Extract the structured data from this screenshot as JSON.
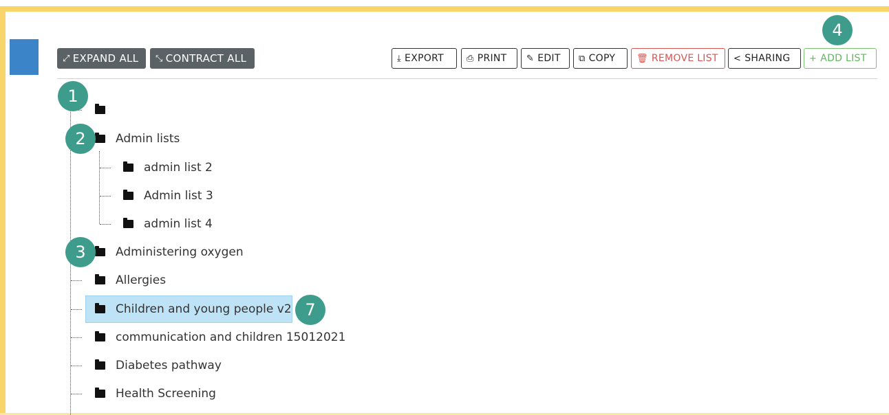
{
  "toolbar": {
    "expand_all": "EXPAND ALL",
    "contract_all": "CONTRACT ALL",
    "export": "EXPORT",
    "print": "PRINT",
    "edit": "EDIT",
    "copy": "COPY",
    "remove_list": "REMOVE LIST",
    "sharing": "SHARING",
    "add_list": "ADD LIST"
  },
  "tree": {
    "root_label": "",
    "admin_lists": "Admin lists",
    "admin_children": [
      "admin list 2",
      "Admin list 3",
      "admin list 4"
    ],
    "items": [
      "Administering oxygen",
      "Allergies",
      "Children and young people v2",
      "communication and children 15012021",
      "Diabetes pathway",
      "Health Screening"
    ],
    "selected_item": "Children and young people v2"
  },
  "markers": [
    "1",
    "2",
    "3",
    "4",
    "7"
  ],
  "colors": {
    "frame": "#f8d56b",
    "dark_button": "#5b6266",
    "marker": "#3e9c8c",
    "selected_bg": "#bfe3f6",
    "remove": "#d9534f",
    "add": "#5cb85c",
    "side_tab": "#3a84c7"
  },
  "icons": {
    "expand": "expand-arrows-icon",
    "contract": "compress-arrows-icon",
    "export": "download-icon",
    "print": "printer-icon",
    "edit": "pencil-icon",
    "copy": "copy-icon",
    "remove": "trash-icon",
    "sharing": "share-icon",
    "add": "plus-icon",
    "folder": "folder-icon"
  }
}
